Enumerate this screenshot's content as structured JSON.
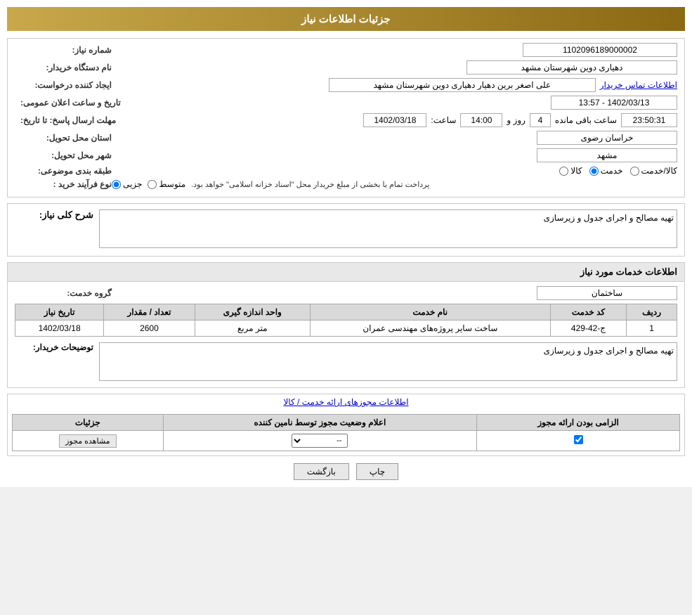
{
  "header": {
    "title": "جزئیات اطلاعات نیاز"
  },
  "main_info": {
    "need_number_label": "شماره نیاز:",
    "need_number_value": "1102096189000002",
    "buyer_org_label": "نام دستگاه خریدار:",
    "buyer_org_value": "دهیاری دوین  شهرستان مشهد",
    "requester_label": "ایجاد کننده درخواست:",
    "requester_value": "علی اصغر برین دهیار دهیاری دوین  شهرستان مشهد",
    "contact_link": "اطلاعات تماس خریدار",
    "announce_datetime_label": "تاریخ و ساعت اعلان عمومی:",
    "announce_datetime_value": "1402/03/13 - 13:57",
    "response_deadline_label": "مهلت ارسال پاسخ: تا تاریخ:",
    "response_deadline_date": "1402/03/18",
    "response_deadline_time_label": "ساعت:",
    "response_deadline_time": "14:00",
    "remaining_days_label": "روز و",
    "remaining_days": "4",
    "remaining_time_label": "ساعت باقی مانده",
    "remaining_time": "23:50:31",
    "province_label": "استان محل تحویل:",
    "province_value": "خراسان رضوی",
    "city_label": "شهر محل تحویل:",
    "city_value": "مشهد",
    "category_label": "طبقه بندی موضوعی:",
    "category_kala": "کالا",
    "category_khadamat": "خدمت",
    "category_kala_khadamat": "کالا/خدمت",
    "category_selected": "khadamat",
    "purchase_type_label": "نوع فرآیند خرید :",
    "purchase_type_jozii": "جزیی",
    "purchase_type_mootasat": "متوسط",
    "purchase_type_note": "پرداخت تمام یا بخشی از مبلغ خریدار محل \"اسناد خزانه اسلامی\" خواهد بود.",
    "purchase_type_selected": "jozii"
  },
  "description": {
    "section_title": "شرح کلی نیاز:",
    "value": "تهیه مصالح و اجرای جدول و زیرسازی"
  },
  "services_info": {
    "section_title": "اطلاعات خدمات مورد نیاز",
    "service_group_label": "گروه خدمت:",
    "service_group_value": "ساختمان",
    "table_headers": [
      "ردیف",
      "کد خدمت",
      "نام خدمت",
      "واحد اندازه گیری",
      "تعداد / مقدار",
      "تاریخ نیاز"
    ],
    "table_rows": [
      {
        "row": "1",
        "code": "ج-42-429",
        "name": "ساخت سایر پروژه‌های مهندسی عمران",
        "unit": "متر مربع",
        "qty": "2600",
        "date": "1402/03/18"
      }
    ],
    "buyer_description_label": "توضیحات خریدار:",
    "buyer_description_value": "تهیه مصالح و اجرای جدول و زیرسازی"
  },
  "licenses": {
    "section_link": "اطلاعات مجوزهای ارائه خدمت / کالا",
    "table_headers": [
      "الزامی بودن ارائه مجوز",
      "اعلام وضعیت مجوز توسط نامین کننده",
      "جزئیات"
    ],
    "table_rows": [
      {
        "required_checked": true,
        "status_value": "--",
        "details_btn": "مشاهده مجوز"
      }
    ]
  },
  "buttons": {
    "print": "چاپ",
    "back": "بازگشت"
  }
}
